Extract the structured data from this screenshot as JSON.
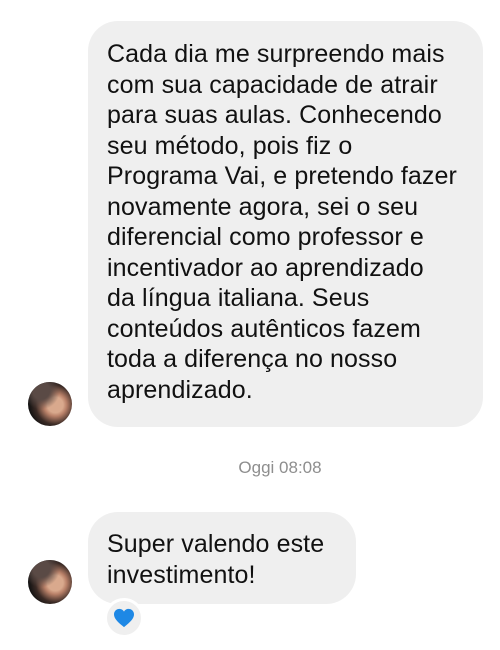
{
  "messages": [
    {
      "lines": [
        "Cada dia me surpreendo mais",
        "com sua capacidade de atrair",
        "para suas aulas. Conhecendo",
        "seu método,  pois fiz o",
        "Programa Vai, e pretendo fazer",
        "novamente agora, sei o seu",
        "diferencial como professor e",
        "incentivador ao aprendizado",
        "da língua italiana. Seus",
        "conteúdos autênticos fazem",
        "toda a diferença no nosso",
        "aprendizado."
      ]
    },
    {
      "lines": [
        "Super valendo este",
        "investimento!"
      ],
      "reaction": {
        "icon": "blue-heart-icon",
        "color": "#1e88e5"
      }
    }
  ],
  "timestamp": "Oggi 08:08",
  "colors": {
    "bubble": "#efefef",
    "timestamp": "#8e8e8e",
    "text": "#111111"
  }
}
